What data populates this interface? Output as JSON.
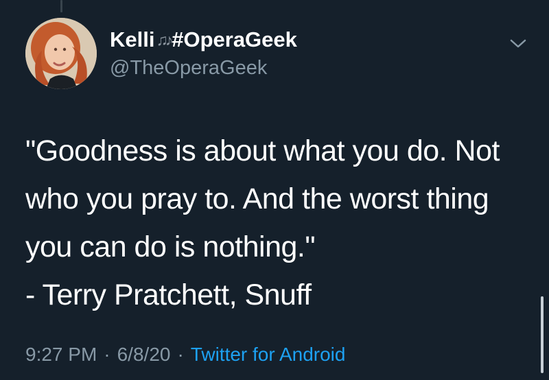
{
  "tweet": {
    "author": {
      "display_name_prefix": "Kelli",
      "display_name_icon": "♫♪",
      "display_name_suffix": "#OperaGeek",
      "handle": "@TheOperaGeek"
    },
    "text_lines": [
      "\"Goodness is about what you do. Not",
      "who you pray to. And the worst thing",
      "you can do is nothing.\"",
      "- Terry Pratchett, Snuff"
    ],
    "meta": {
      "time": "9:27 PM",
      "separator": "·",
      "date": "6/8/20",
      "source": "Twitter for Android"
    }
  },
  "icons": {
    "avatar": "avatar",
    "caret": "chevron-down-icon",
    "music": "music-notes-icon"
  },
  "colors": {
    "background": "#15202b",
    "text": "#ffffff",
    "secondary": "#8899a6",
    "accent": "#1da1f2"
  }
}
